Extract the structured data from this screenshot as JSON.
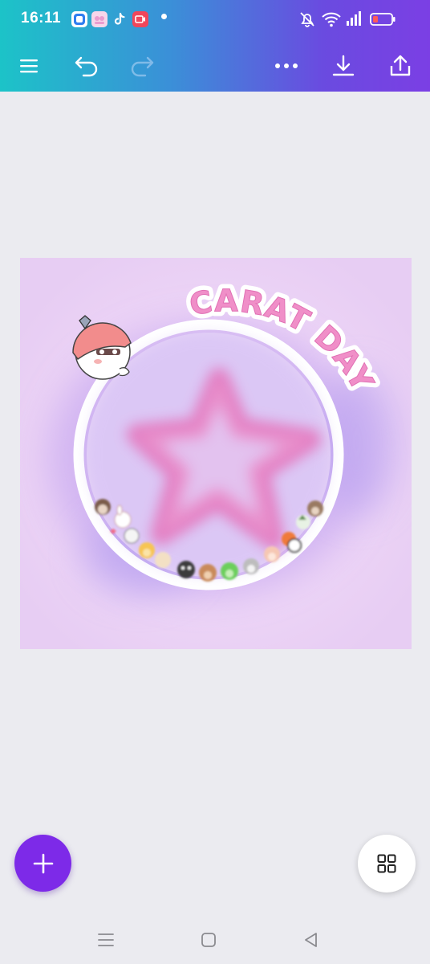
{
  "status_bar": {
    "time": "16:11",
    "icons": [
      "app-icon-blue",
      "app-icon-pink",
      "tiktok-icon",
      "screen-recorder-icon",
      "notification-dot",
      "mute-icon",
      "wifi-icon",
      "signal-icon",
      "battery-icon"
    ]
  },
  "toolbar": {
    "icons": [
      "menu-icon",
      "undo-icon",
      "redo-icon",
      "more-icon",
      "download-icon",
      "share-icon"
    ],
    "redo_enabled": false
  },
  "design": {
    "title_text": "CARAT DAY",
    "colors": {
      "title_fill": "#f08fc8",
      "frame": "#ffffff",
      "star": "#e47ac0",
      "background": "#eed8f5"
    }
  },
  "fab": {
    "add_icon": "plus-icon",
    "pages_icon": "grid-icon",
    "add_color": "#7d2ae8"
  },
  "system_nav": {
    "icons": [
      "recents-icon",
      "home-icon",
      "back-icon"
    ]
  }
}
